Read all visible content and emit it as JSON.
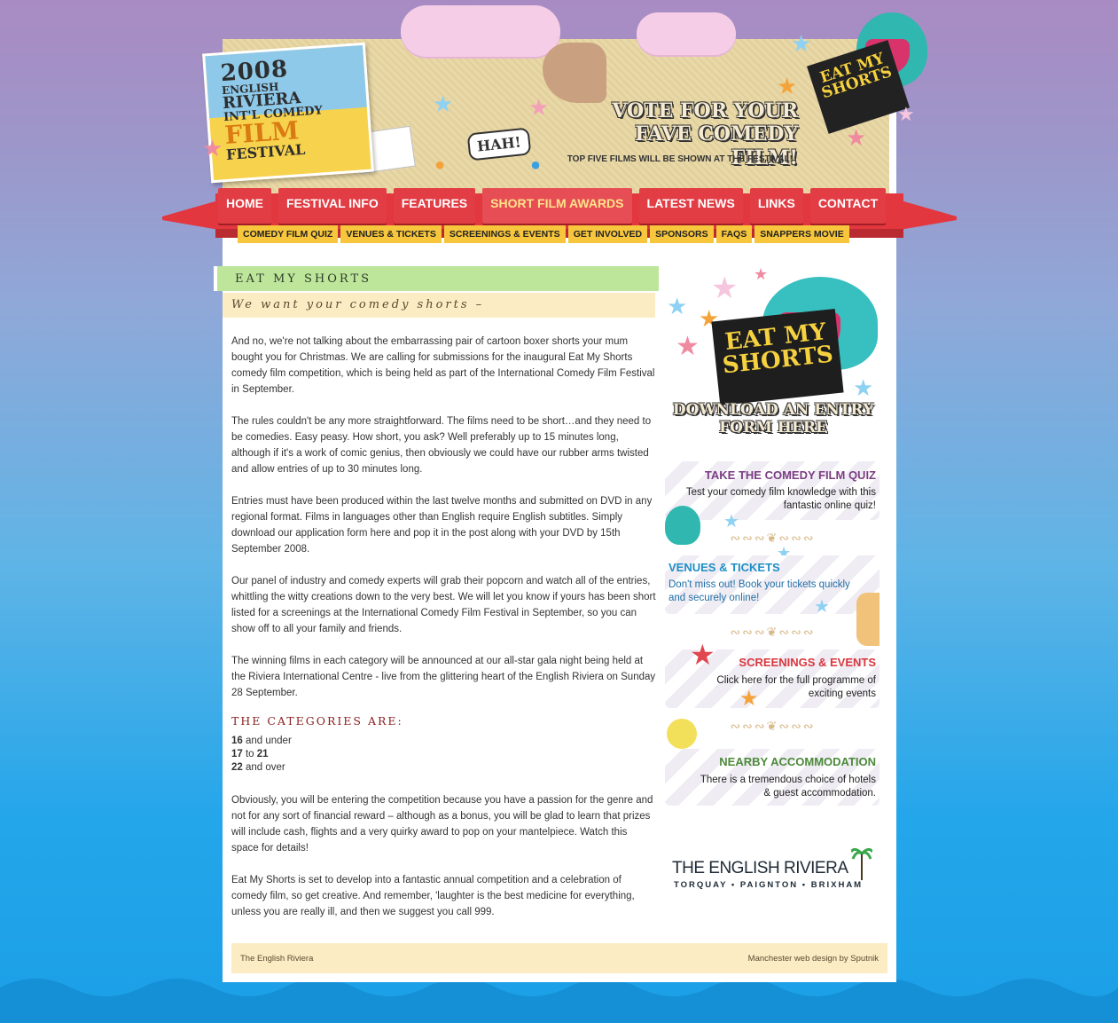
{
  "header": {
    "logo": {
      "line1": "2008",
      "line2": "ENGLISH",
      "line3": "RIVIERA",
      "line4": "INT'L COMEDY",
      "line5": "FILM",
      "line6": "FESTIVAL"
    },
    "hah_label": "HAH!",
    "vote_line1": "VOTE FOR YOUR",
    "vote_line2": "FAVE COMEDY FILM!",
    "vote_sub": "TOP FIVE FILMS WILL BE SHOWN AT THE FESTIVAL!",
    "badge_text": "EAT MY SHORTS"
  },
  "nav": {
    "main": [
      "HOME",
      "FESTIVAL INFO",
      "FEATURES",
      "SHORT FILM AWARDS",
      "LATEST NEWS",
      "LINKS",
      "CONTACT"
    ],
    "active": "SHORT FILM AWARDS",
    "sub": [
      "COMEDY FILM QUIZ",
      "VENUES & TICKETS",
      "SCREENINGS & EVENTS",
      "GET INVOLVED",
      "SPONSORS",
      "FAQS",
      "SNAPPERS MOVIE"
    ]
  },
  "article": {
    "title": "EAT MY SHORTS",
    "subtitle": "We want your comedy shorts –",
    "paragraphs": [
      "And no, we're not talking about the embarrassing pair of cartoon boxer shorts your mum bought you for Christmas. We are calling for submissions for the inaugural Eat My Shorts comedy film competition, which is being held as part of the International Comedy Film Festival in September.",
      "The rules couldn't be any more straightforward. The films need to be short…and they need to be comedies. Easy peasy. How short, you ask? Well preferably up to 15 minutes long, although if it's a work of comic genius, then obviously we could have our rubber arms twisted and allow entries of up to 30 minutes long.",
      "Entries must have been produced within the last twelve months and submitted on DVD in any regional format. Films in languages other than English require English subtitles. Simply download our application form here and pop it in the post along with your DVD by 15th September 2008.",
      "Our panel of industry and comedy experts will grab their popcorn and watch all of the entries, whittling the witty creations down to the very best. We will let you know if yours has been short listed for a screenings at the International Comedy Film Festival in September, so you can show off to all your family and friends.",
      "The winning films in each category will be announced at our all-star gala night being held at the Riviera International Centre - live from the glittering heart of the English Riviera on Sunday 28 September."
    ],
    "categories_heading": "THE CATEGORIES ARE:",
    "categories": [
      {
        "bold": "16",
        "rest": " and under"
      },
      {
        "bold": "17",
        "mid": " to ",
        "bold2": "21"
      },
      {
        "bold": "22",
        "rest": " and over"
      }
    ],
    "paragraphs_after": [
      "Obviously, you will be entering the competition because you have a passion for the genre and not for any sort of financial reward – although as a bonus, you will be glad to learn that prizes will include cash, flights and a very quirky award to pop on your mantelpiece. Watch this space for details!",
      "Eat My Shorts is set to develop into a fantastic annual competition and a celebration of comedy film, so get creative. And remember, 'laughter is the best medicine for everything, unless you are really ill, and then we suggest you call 999."
    ]
  },
  "sidebar": {
    "promo_sign": "EAT MY SHORTS",
    "promo_line1": "DOWNLOAD AN ENTRY",
    "promo_line2": "FORM HERE",
    "boxes": [
      {
        "heading": "TAKE THE COMEDY FILM QUIZ",
        "text": "Test your comedy film knowledge with this fantastic online quiz!",
        "color": "#7a3d82"
      },
      {
        "heading": "VENUES & TICKETS",
        "text": "Don't miss out! Book your tickets quickly and securely online!",
        "color": "#1f8fc6"
      },
      {
        "heading": "SCREENINGS & EVENTS",
        "text": "Click here for the full programme of exciting events",
        "color": "#d9363e"
      },
      {
        "heading": "NEARBY ACCOMMODATION",
        "text": "There is a tremendous choice of hotels & guest accommodation.",
        "color": "#4c8a3a"
      }
    ],
    "riviera_title": "THE ENGLISH RIVIERA",
    "riviera_towns": "TORQUAY • PAIGNTON • BRIXHAM"
  },
  "footer": {
    "left": "The English Riviera",
    "right": "Manchester web design by Sputnik"
  }
}
